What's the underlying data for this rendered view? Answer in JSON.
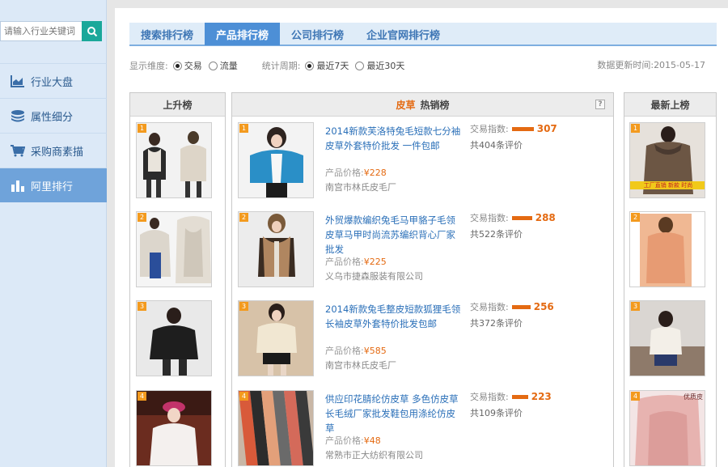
{
  "sidebar": {
    "search_placeholder": "请输入行业关键词",
    "items": [
      {
        "label": "行业大盘",
        "icon": "chart-icon"
      },
      {
        "label": "属性细分",
        "icon": "layers-icon"
      },
      {
        "label": "采购商素描",
        "icon": "cart-icon"
      },
      {
        "label": "阿里排行",
        "icon": "bar-chart-icon",
        "active": true
      }
    ]
  },
  "tabs": [
    {
      "label": "搜索排行榜"
    },
    {
      "label": "产品排行榜",
      "active": true
    },
    {
      "label": "公司排行榜"
    },
    {
      "label": "企业官网排行榜"
    }
  ],
  "filters": {
    "dimension_label": "显示维度:",
    "dimension_options": [
      "交易",
      "流量"
    ],
    "period_label": "统计周期:",
    "period_options": [
      "最近7天",
      "最近30天"
    ],
    "update_label": "数据更新时间:",
    "update_value": "2015-05-17"
  },
  "panels": {
    "rising_title": "上升榜",
    "hot_category": "皮草",
    "hot_title": "热销榜",
    "new_title": "最新上榜"
  },
  "products": [
    {
      "rank": "1",
      "title": "2014新款芙洛特兔毛短款七分袖皮草外套特价批发 一件包邮",
      "price_label": "产品价格:",
      "price": "¥228",
      "company": "南宫市林氏皮毛厂",
      "trade_label": "交易指数:",
      "trade_index": 307,
      "reviews": "共404条评价"
    },
    {
      "rank": "2",
      "title": "外贸爆款编织兔毛马甲貉子毛领皮草马甲时尚流苏编织背心厂家批发",
      "price_label": "产品价格:",
      "price": "¥225",
      "company": "义乌市捷森服装有限公司",
      "trade_label": "交易指数:",
      "trade_index": 288,
      "reviews": "共522条评价"
    },
    {
      "rank": "3",
      "title": "2014新款兔毛整皮短款狐狸毛领长袖皮草外套特价批发包邮",
      "price_label": "产品价格:",
      "price": "¥585",
      "company": "南宫市林氏皮毛厂",
      "trade_label": "交易指数:",
      "trade_index": 256,
      "reviews": "共372条评价"
    },
    {
      "rank": "4",
      "title": "供应印花腈纶仿皮草 多色仿皮草长毛绒厂家批发鞋包用涤纶仿皮草",
      "price_label": "产品价格:",
      "price": "¥48",
      "company": "常熟市正大纺织有限公司",
      "trade_label": "交易指数:",
      "trade_index": 223,
      "reviews": "共109条评价"
    }
  ],
  "rising": [
    {
      "rank": "1"
    },
    {
      "rank": "2"
    },
    {
      "rank": "3"
    },
    {
      "rank": "4"
    }
  ],
  "newest": [
    {
      "rank": "1",
      "caption": "工厂直销 新款 时尚"
    },
    {
      "rank": "2"
    },
    {
      "rank": "3"
    },
    {
      "rank": "4",
      "caption": "优质皮"
    }
  ],
  "colors": {
    "accent_blue": "#4d8fd6",
    "orange": "#e46a12",
    "teal": "#1aa89a"
  }
}
